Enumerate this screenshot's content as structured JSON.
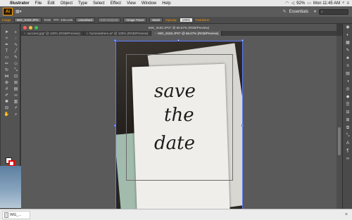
{
  "menubar": {
    "apple_icon": "apple-icon",
    "items": [
      "Illustrator",
      "File",
      "Edit",
      "Object",
      "Type",
      "Select",
      "Effect",
      "View",
      "Window",
      "Help"
    ],
    "battery": "92%",
    "clock": "Mon 11:45 AM"
  },
  "appbar": {
    "logo": "Ai",
    "workspace": "Essentials"
  },
  "controlbar": {
    "mode": "Image",
    "file": "IMG_9183.JPG",
    "color_mode": "RGB",
    "ppi_label": "PPI: 335x185",
    "embed": "Unembed",
    "edit_original": "Edit Original",
    "image_trace": "Image Trace",
    "mask": "Mask",
    "opacity_label": "Opacity:",
    "opacity_value": "100%",
    "transform": "Transform"
  },
  "window": {
    "title": "IMG_9183.JPG* @ 66.67% (RGB/Preview)"
  },
  "tabs": [
    {
      "label": "success.jpg* @ 100% (RGB/Preview)"
    },
    {
      "label": "homeiswhere.ai* @ 100% (RGB/Preview)"
    },
    {
      "label": "IMG_9183.JPG* @ 66.67% (RGB/Preview)"
    }
  ],
  "artwork": {
    "lines": [
      "save",
      "the",
      "date"
    ]
  },
  "download": {
    "filename": "IMG_..."
  }
}
